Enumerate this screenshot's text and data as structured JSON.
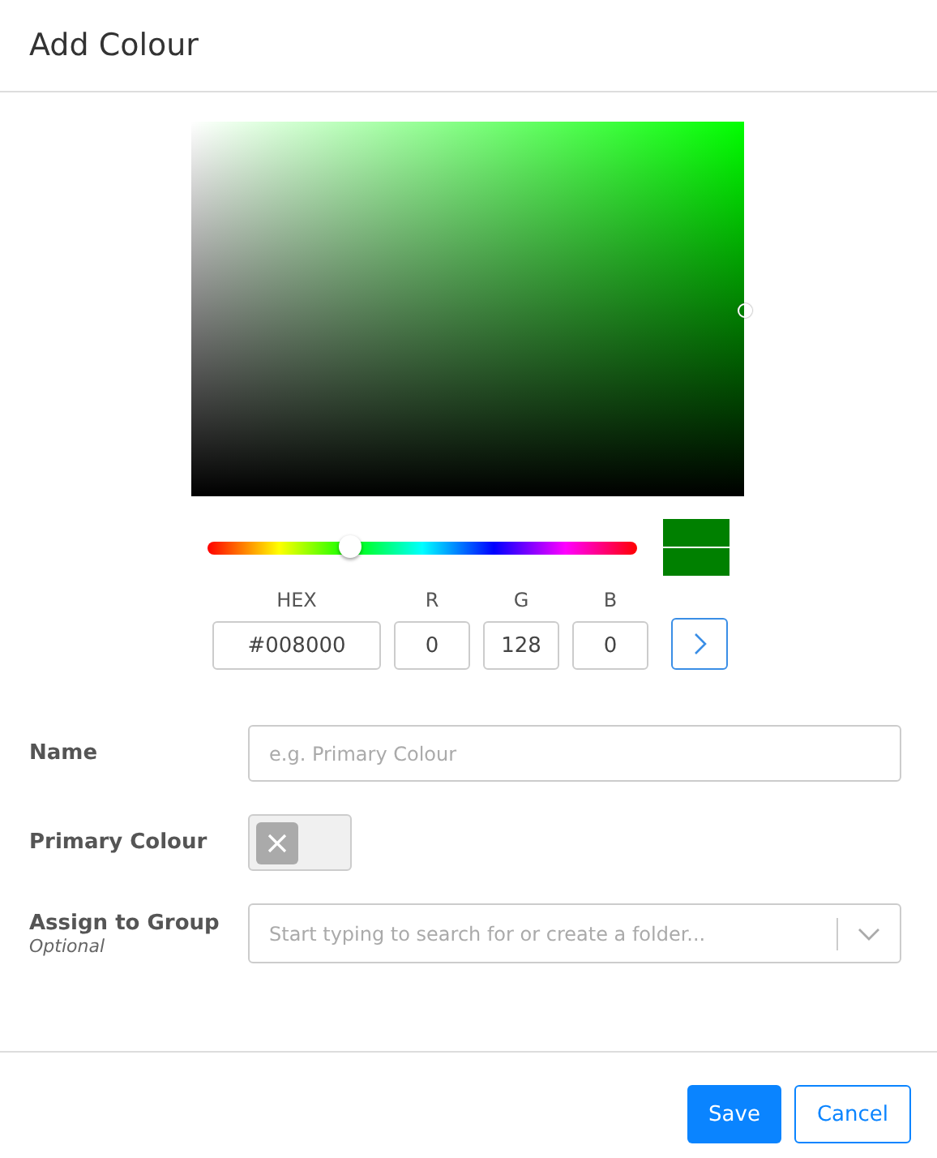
{
  "dialog": {
    "title": "Add Colour"
  },
  "picker": {
    "hue": {
      "level": 0.333
    }
  },
  "swatches": [
    {
      "color": "#008000"
    },
    {
      "color": "#008000"
    }
  ],
  "channels": [
    {
      "label": "HEX",
      "value": "#008000",
      "kind": "hex"
    },
    {
      "label": "R",
      "value": "0",
      "kind": "num"
    },
    {
      "label": "G",
      "value": "128",
      "kind": "num"
    },
    {
      "label": "B",
      "value": "0",
      "kind": "num"
    }
  ],
  "form": {
    "name": {
      "label": "Name",
      "placeholder": "e.g. Primary Colour"
    },
    "primary": {
      "label": "Primary Colour",
      "on": false
    },
    "group": {
      "label": "Assign to Group",
      "hint": "Optional",
      "placeholder": "Start typing to search for or create a folder..."
    }
  },
  "buttons": {
    "save": "Save",
    "cancel": "Cancel"
  }
}
